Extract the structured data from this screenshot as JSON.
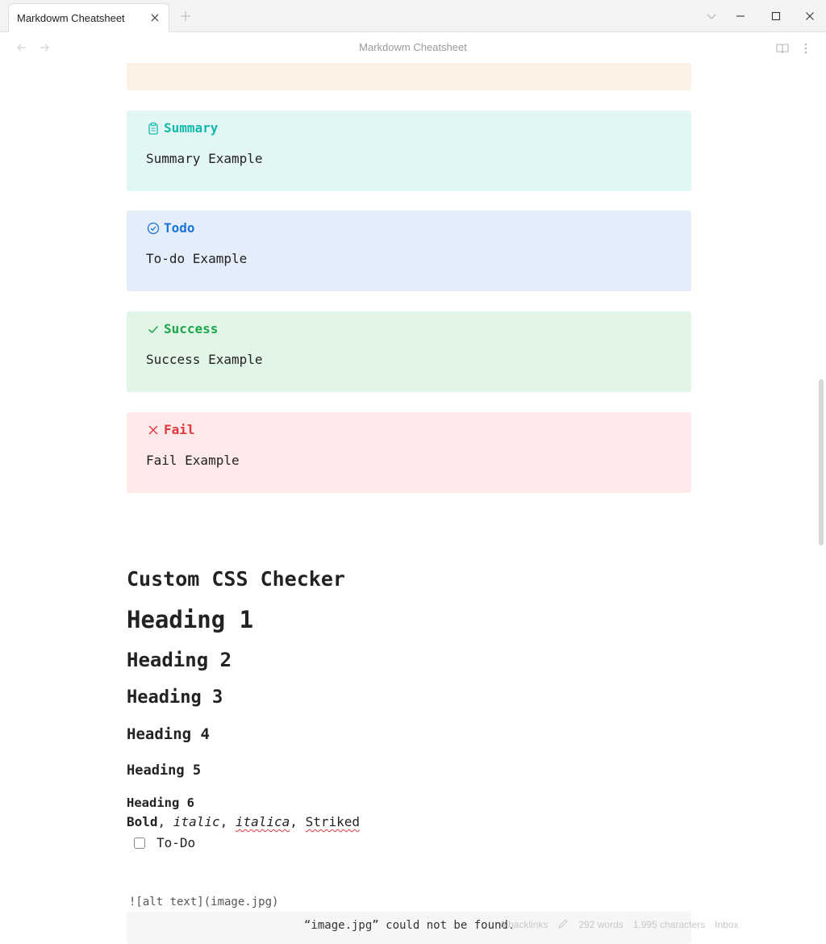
{
  "window": {
    "tab_title": "Markdowm Cheatsheet"
  },
  "header": {
    "title": "Markdowm Cheatsheet"
  },
  "callouts": [
    {
      "id": "summary",
      "title": "Summary",
      "body": "Summary Example",
      "bg": "#e2f7f4",
      "accent": "#12b8ad",
      "icon": "clipboard-icon"
    },
    {
      "id": "todo",
      "title": "Todo",
      "body": "To-do Example",
      "bg": "#e4eefb",
      "accent": "#1a73d8",
      "icon": "check-circle-icon"
    },
    {
      "id": "success",
      "title": "Success",
      "body": "Success Example",
      "bg": "#e2f6e8",
      "accent": "#1fa84a",
      "icon": "checkmark-icon"
    },
    {
      "id": "fail",
      "title": "Fail",
      "body": "Fail Example",
      "bg": "#fde8ea",
      "accent": "#e0383e",
      "icon": "x-icon"
    }
  ],
  "partial_callout_bg": "#fdf0e4",
  "custom_css": {
    "title": "Custom CSS Checker",
    "h1": "Heading 1",
    "h2": "Heading 2",
    "h3": "Heading 3",
    "h4": "Heading 4",
    "h5": "Heading 5",
    "h6": "Heading 6",
    "bold": "Bold",
    "italic": "italic",
    "italica": "italica",
    "striked": "Striked",
    "todo_label": "To-Do",
    "image_code": "![alt text](image.jpg)",
    "image_missing": "“image.jpg” could not be found."
  },
  "status": {
    "backlinks": "0 backlinks",
    "words": "292 words",
    "characters": "1,995 characters",
    "inbox": "Inbox"
  }
}
